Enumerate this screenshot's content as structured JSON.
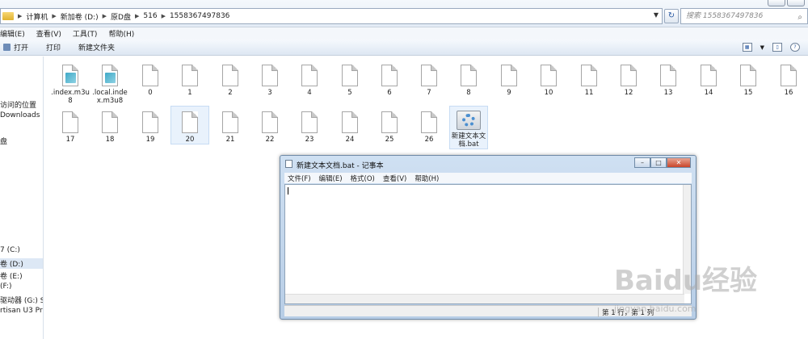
{
  "address": {
    "crumbs": [
      "计算机",
      "新加卷 (D:)",
      "原D盘",
      "516",
      "1558367497836"
    ]
  },
  "search": {
    "placeholder": "搜索 1558367497836"
  },
  "menubar": [
    "编辑(E)",
    "查看(V)",
    "工具(T)",
    "帮助(H)"
  ],
  "commands": {
    "open": "打开",
    "print": "打印",
    "new_folder": "新建文件夹"
  },
  "navpane": {
    "items": [
      {
        "label": "访问的位置"
      },
      {
        "label": "Downloads"
      },
      {
        "label": "盘"
      },
      {
        "label": "7 (C:)"
      },
      {
        "label": "卷 (D:)"
      },
      {
        "label": "卷 (E:)"
      },
      {
        "label": "(F:)"
      },
      {
        "label": "驱动器 (G:) Sma"
      },
      {
        "label": "rtisan U3 Pro"
      }
    ]
  },
  "files": [
    {
      "name": ".index.m3u8",
      "type": "m3u8"
    },
    {
      "name": ".local.index.m3u8",
      "type": "m3u8"
    },
    {
      "name": "0"
    },
    {
      "name": "1"
    },
    {
      "name": "2"
    },
    {
      "name": "3"
    },
    {
      "name": "4"
    },
    {
      "name": "5"
    },
    {
      "name": "6"
    },
    {
      "name": "7"
    },
    {
      "name": "8"
    },
    {
      "name": "9"
    },
    {
      "name": "10"
    },
    {
      "name": "11"
    },
    {
      "name": "12"
    },
    {
      "name": "13"
    },
    {
      "name": "14"
    },
    {
      "name": "15"
    },
    {
      "name": "16"
    },
    {
      "name": "17"
    },
    {
      "name": "18"
    },
    {
      "name": "19"
    },
    {
      "name": "20"
    },
    {
      "name": "21"
    },
    {
      "name": "22"
    },
    {
      "name": "23"
    },
    {
      "name": "24"
    },
    {
      "name": "25"
    },
    {
      "name": "26"
    },
    {
      "name": "新建文本文档.bat",
      "type": "bat"
    }
  ],
  "notepad": {
    "title": "新建文本文档.bat - 记事本",
    "menu": [
      "文件(F)",
      "编辑(E)",
      "格式(O)",
      "查看(V)",
      "帮助(H)"
    ],
    "status": "第 1 行，第 1 列"
  },
  "watermark": {
    "brand": "Baidu经验",
    "url": "jingyan.baidu.com"
  },
  "colors": {
    "accent": "#2a5aa3",
    "selection": "#dde8f5",
    "close": "#c9452a"
  }
}
